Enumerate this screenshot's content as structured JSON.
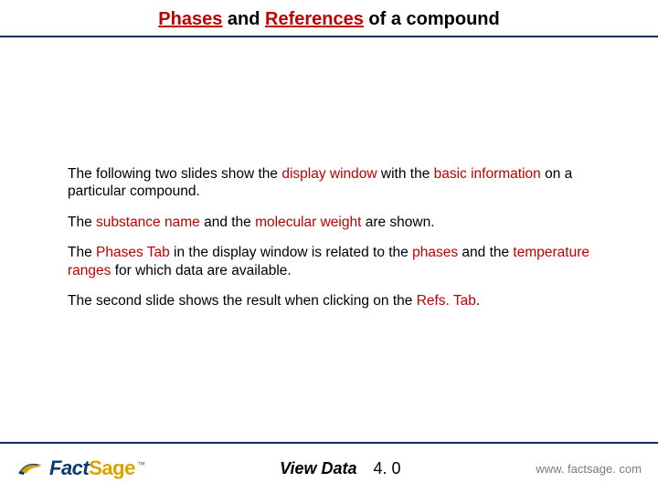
{
  "title": {
    "pre": "",
    "k1": "Phases",
    "mid1": " and ",
    "k2": "References",
    "post": " of a compound"
  },
  "paragraphs": {
    "p1": {
      "t0": "The following two slides show the ",
      "k0": "display window",
      "t1": " with the ",
      "k1": "basic information",
      "t2": " on a particular compound."
    },
    "p2": {
      "t0": "The ",
      "k0": "substance name",
      "t1": " and the ",
      "k1": "molecular weight",
      "t2": " are shown."
    },
    "p3": {
      "t0": "The ",
      "k0": "Phases Tab",
      "t1": " in the display window is related to the ",
      "k1": "phases",
      "t2": " and the ",
      "k2": "temperature ranges",
      "t3": " for which data are available."
    },
    "p4": {
      "t0": "The second slide shows the result when clicking on the ",
      "k0": "Refs. Tab",
      "t1": "."
    }
  },
  "footer": {
    "logo_text_1": "Fact",
    "logo_text_2": "Sage",
    "center_label": "View Data",
    "center_version": "4. 0",
    "right_text": "www. factsage. com"
  },
  "colors": {
    "accent_rule": "#00305e",
    "highlight": "#c00000",
    "logo_blue": "#0a3b6c",
    "logo_gold": "#d9a400"
  }
}
